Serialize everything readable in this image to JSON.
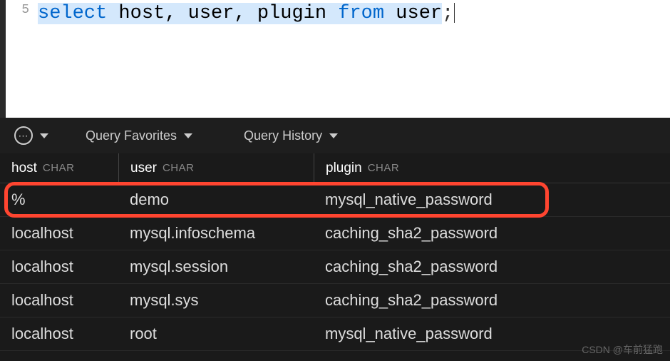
{
  "editor": {
    "line_number": "5",
    "tokens": {
      "select": "select",
      "host": "host",
      "user": "user",
      "plugin": "plugin",
      "from": "from",
      "user2": "user",
      "semi": ";"
    }
  },
  "toolbar": {
    "favorites_label": "Query Favorites",
    "history_label": "Query History"
  },
  "results": {
    "columns": [
      {
        "name": "host",
        "type": "CHAR"
      },
      {
        "name": "user",
        "type": "CHAR"
      },
      {
        "name": "plugin",
        "type": "CHAR"
      }
    ],
    "rows": [
      {
        "host": "%",
        "user": "demo",
        "plugin": "mysql_native_password",
        "highlighted": true
      },
      {
        "host": "localhost",
        "user": "mysql.infoschema",
        "plugin": "caching_sha2_password"
      },
      {
        "host": "localhost",
        "user": "mysql.session",
        "plugin": "caching_sha2_password"
      },
      {
        "host": "localhost",
        "user": "mysql.sys",
        "plugin": "caching_sha2_password"
      },
      {
        "host": "localhost",
        "user": "root",
        "plugin": "mysql_native_password"
      }
    ]
  },
  "watermark": "CSDN @车前猛跑"
}
